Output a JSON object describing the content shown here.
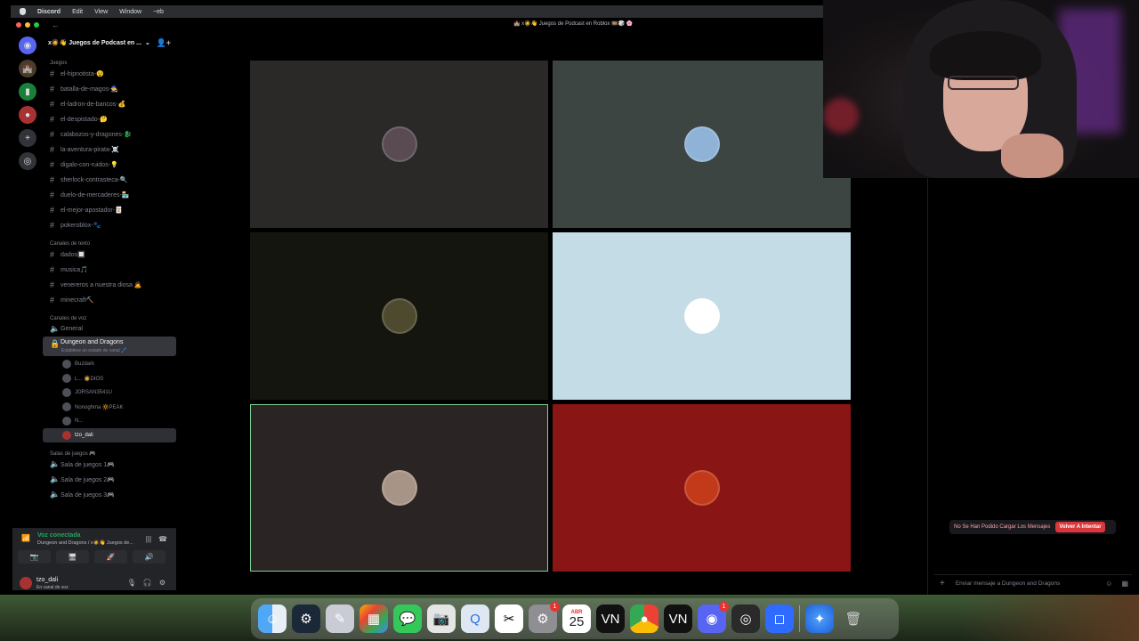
{
  "menubar": {
    "app": "Discord",
    "items": [
      "Edit",
      "View",
      "Window",
      "~eb"
    ]
  },
  "window": {
    "title": "🏰 x🧔👋 Juegos de Podcast en Roblox 🎞️🎲 🌸"
  },
  "server": {
    "name": "x🧔👋 Juegos de Podcast en ..."
  },
  "categories": {
    "juegos": "Juegos",
    "texto": "Canales de texto",
    "voz": "Canales de voz",
    "salas": "Salas de juegos 🎮"
  },
  "juegos_channels": [
    "el-hipnotista-😵",
    "batalla-de-magos-🧙",
    "el-ladron-de-bancos-💰",
    "el-despistado-🤔",
    "calabozos-y-dragones-🐉",
    "la-aventura-pirata-☠️",
    "digalo-con-ruidos-💡",
    "sherlock-contrasteca-🔍",
    "duelo-de-mercaderes-🏪",
    "el-mejor-apostador-🃏",
    "pokeroblox-🐾"
  ],
  "text_channels": [
    "dados🔲",
    "musica🎵",
    "venereros a nuestra diosa 🙇",
    "minecraft⛏️"
  ],
  "voice_channels": {
    "general": "General",
    "active": "Dungeon and Dragons",
    "active_status": "Establece un estado de canal 🖊️"
  },
  "voice_users": [
    {
      "name": "Buzdark",
      "live": ""
    },
    {
      "name": "L... 🧔DIOS",
      "live": ""
    },
    {
      "name": "JORSAN3541U",
      "live": ""
    },
    {
      "name": "Nonoghma 🔆PEAK",
      "live": ""
    },
    {
      "name": "N...",
      "live": ""
    },
    {
      "name": "tzo_dali",
      "live": ""
    }
  ],
  "salas_channels": [
    "Sala de juegos 1🎮",
    "Sala de juegos 2🎮",
    "Sala de juegos 3🎮"
  ],
  "voice_panel": {
    "status": "Voz conectada",
    "channel": "Dungeon and Dragons / x🧔👋 Juegos de..."
  },
  "user": {
    "name": "tzo_dali",
    "status": "En canal de voz"
  },
  "tiles": [
    {
      "bg": "#2b2828",
      "avatar": "#5a4a52"
    },
    {
      "bg": "#3d4543",
      "avatar": "#8fb3d6"
    },
    {
      "bg": "#151510",
      "avatar": "#4e4a30"
    },
    {
      "bg": "#c3dce6",
      "avatar": "#ffffff"
    },
    {
      "bg": "#2b2424",
      "avatar": "#a89486"
    },
    {
      "bg": "#8a1515",
      "avatar": "#c23a1a"
    }
  ],
  "chat": {
    "error": "No Se Han Podido Cargar Los Mensajes",
    "retry": "Volver A Intentar",
    "placeholder": "Enviar mensaje a Dungeon and Dragons"
  },
  "dock": {
    "calendar_month": "ABR",
    "calendar_day": "25",
    "badges": {
      "settings": "1",
      "discord": "1"
    }
  },
  "colors": {
    "accent": "#5865f2",
    "connected": "#23a55a",
    "danger": "#da373c"
  }
}
